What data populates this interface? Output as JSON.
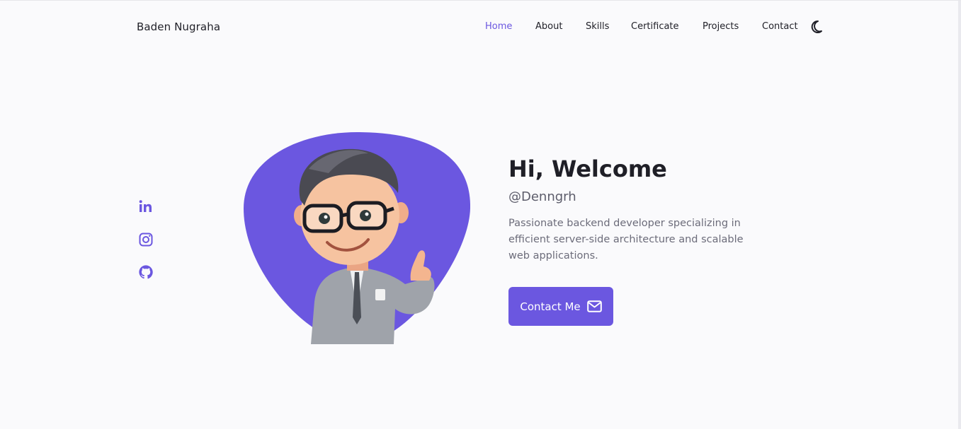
{
  "brand": "Baden Nugraha",
  "nav": {
    "items": [
      {
        "label": "Home",
        "active": true
      },
      {
        "label": "About"
      },
      {
        "label": "Skills"
      },
      {
        "label": "Certificate"
      },
      {
        "label": "Projects"
      },
      {
        "label": "Contact"
      }
    ],
    "theme_toggle_icon": "moon-icon"
  },
  "socials": [
    "linkedin-icon",
    "instagram-icon",
    "github-icon"
  ],
  "hero": {
    "title": "Hi, Welcome",
    "handle": "@Denngrh",
    "description": "Passionate backend developer specializing in efficient server-side architecture and scalable web applications.",
    "button_label": "Contact Me",
    "button_icon": "envelope-icon"
  },
  "colors": {
    "accent": "#6b57e0",
    "background": "#fafafc",
    "text": "#1f1f27",
    "muted": "#6c6c7a"
  }
}
